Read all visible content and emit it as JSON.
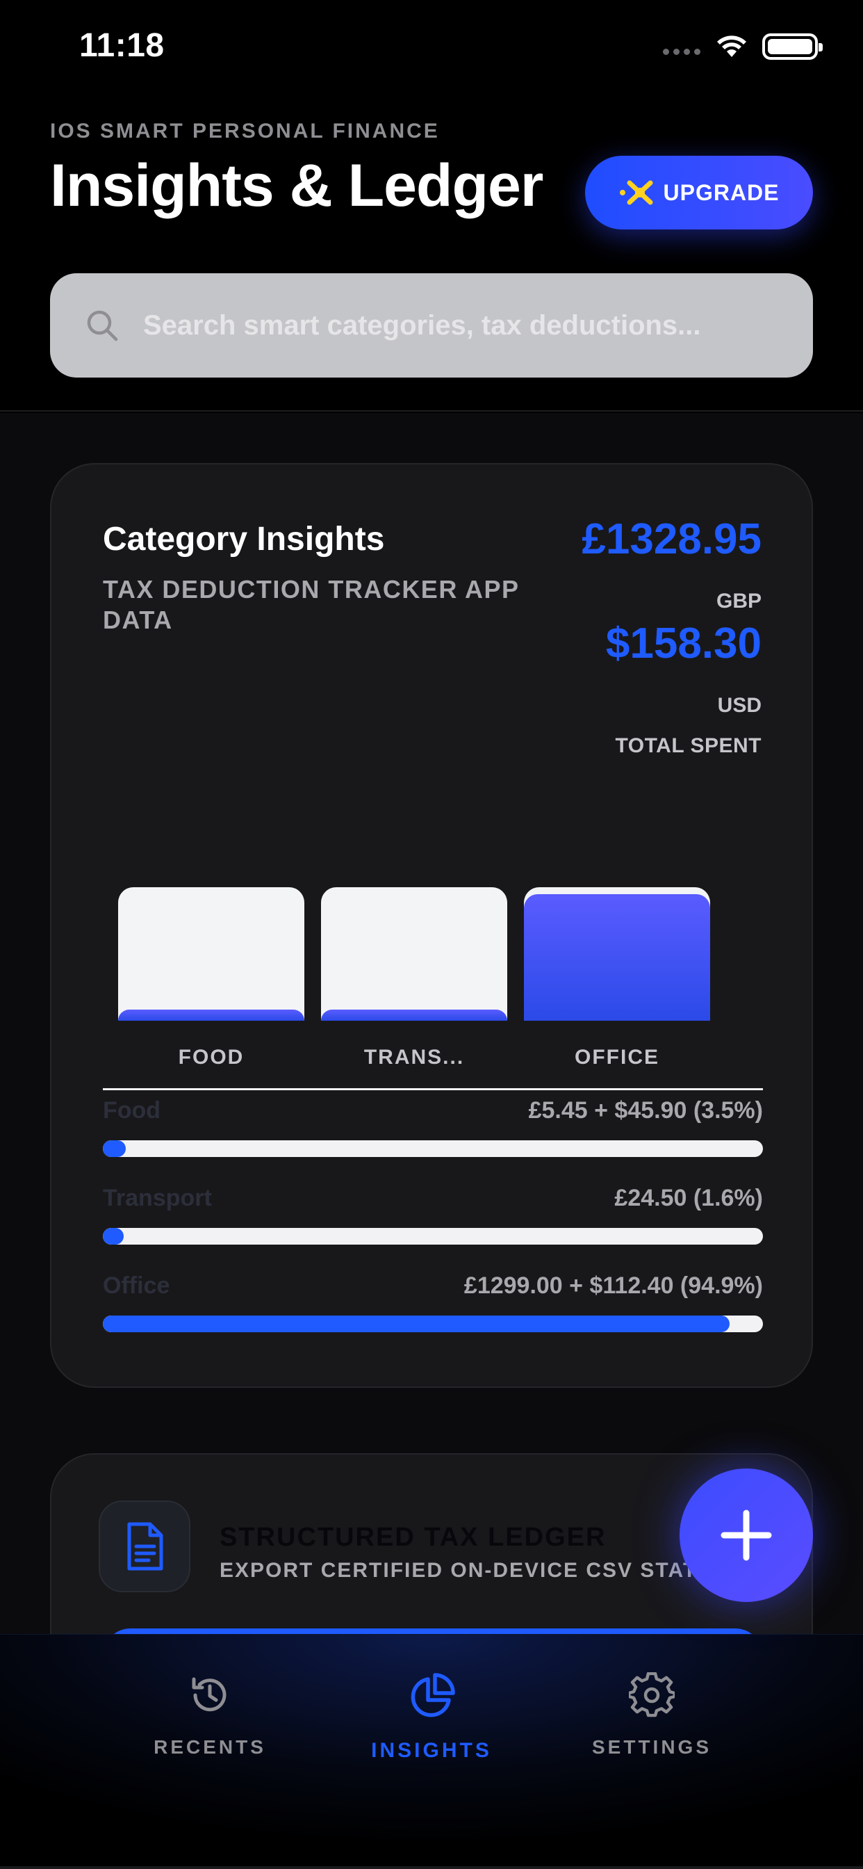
{
  "status_bar": {
    "time": "11:18",
    "icons": [
      "signal-icon",
      "wifi-icon",
      "battery-icon"
    ]
  },
  "header": {
    "eyebrow": "IOS SMART PERSONAL FINANCE",
    "title": "Insights & Ledger",
    "upgrade_label": "UPGRADE",
    "upgrade_icon": "sparkle-x-icon"
  },
  "search": {
    "placeholder": "Search smart categories, tax deductions...",
    "value": "",
    "icon": "search-icon"
  },
  "insights_card": {
    "title": "Category Insights",
    "subtitle": "TAX DEDUCTION TRACKER APP DATA",
    "total_gbp": "£1328.95",
    "gbp_label": "GBP",
    "total_usd": "$158.30",
    "usd_label": "USD",
    "total_label": "TOTAL SPENT"
  },
  "chart_data": {
    "type": "bar",
    "categories": [
      "FOOD",
      "TRANS...",
      "OFFICE"
    ],
    "values": [
      3.5,
      1.6,
      94.9
    ],
    "ylim": [
      0,
      100
    ]
  },
  "breakdown": [
    {
      "name": "Food",
      "value": "£5.45 + $45.90 (3.5%)",
      "percent": 3.5
    },
    {
      "name": "Transport",
      "value": "£24.50 (1.6%)",
      "percent": 1.6
    },
    {
      "name": "Office",
      "value": "£1299.00 + $112.40 (94.9%)",
      "percent": 94.9
    }
  ],
  "ledger_card": {
    "title": "STRUCTURED TAX LEDGER",
    "subtitle": "EXPORT CERTIFIED ON-DEVICE CSV STATE",
    "icon": "document-icon"
  },
  "fab": {
    "icon": "plus-icon"
  },
  "tabs": [
    {
      "label": "RECENTS",
      "icon": "history-icon",
      "active": false
    },
    {
      "label": "INSIGHTS",
      "icon": "pie-chart-icon",
      "active": true
    },
    {
      "label": "SETTINGS",
      "icon": "gear-icon",
      "active": false
    }
  ],
  "colors": {
    "accent": "#1f5bff",
    "accent_purple": "#5a5cff",
    "background": "#000000",
    "card": "#18181b"
  }
}
